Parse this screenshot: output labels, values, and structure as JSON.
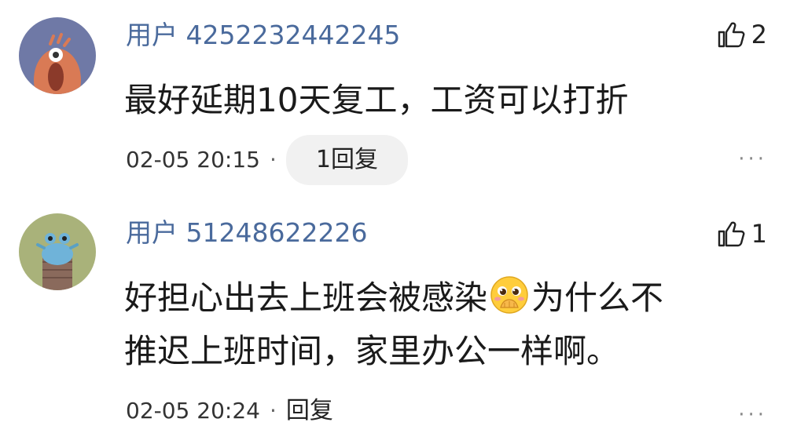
{
  "comments": [
    {
      "username": "用户 4252232442245",
      "likes": "2",
      "text": "最好延期10天复工，工资可以打折",
      "timestamp": "02-05 20:15",
      "separator": "·",
      "reply_label": "1回复",
      "more": "···",
      "avatar_icon": "orange-creature-avatar"
    },
    {
      "username": "用户 51248622226",
      "likes": "1",
      "text_part1": "好担心出去上班会被感染",
      "emoji_icon": "hand-over-mouth-emoji",
      "text_part2": "为什么不",
      "text_line2": "推迟上班时间，家里办公一样啊。",
      "timestamp": "02-05 20:24",
      "separator": "·",
      "reply_label": "回复",
      "more": "···",
      "avatar_icon": "blue-creature-avatar"
    }
  ],
  "colors": {
    "username": "#4a6a9c",
    "text": "#1a1a1a",
    "meta": "#333333",
    "pill_bg": "#f1f1f1"
  }
}
